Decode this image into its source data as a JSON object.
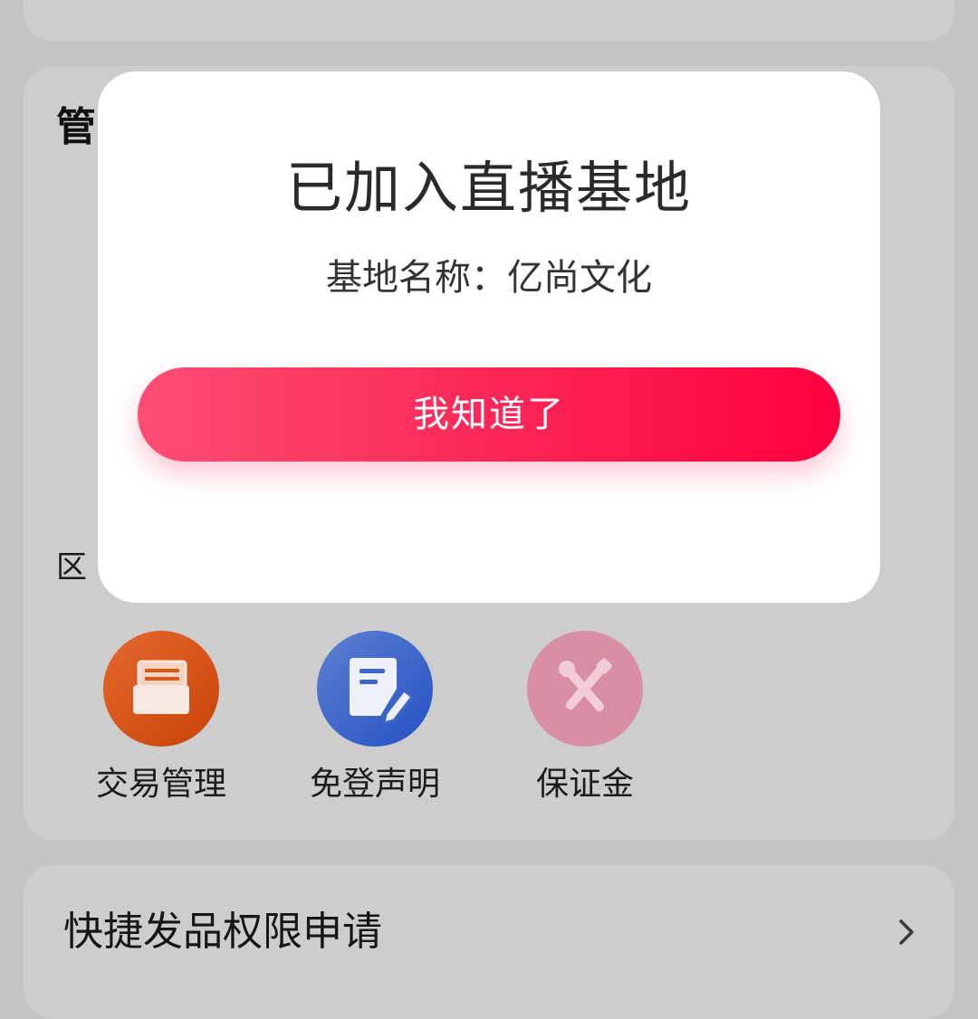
{
  "background": {
    "manage_section": {
      "title_partial": "管",
      "subtitle_partial": "区",
      "items": [
        {
          "label": "交易管理",
          "icon": "drawer-icon",
          "color": "#d9591c"
        },
        {
          "label": "免登声明",
          "icon": "document-edit-icon",
          "color": "#3d66c9"
        },
        {
          "label": "保证金",
          "icon": "wrench-screwdriver-icon",
          "color": "#d88ea4"
        }
      ]
    },
    "quick_publish": {
      "label": "快捷发品权限申请",
      "icon": "chevron-right-icon"
    }
  },
  "dialog": {
    "title": "已加入直播基地",
    "base_name": "基地名称：亿尚文化",
    "confirm_label": "我知道了",
    "accent_start": "#fe4d74",
    "accent_end": "#ff0040"
  }
}
